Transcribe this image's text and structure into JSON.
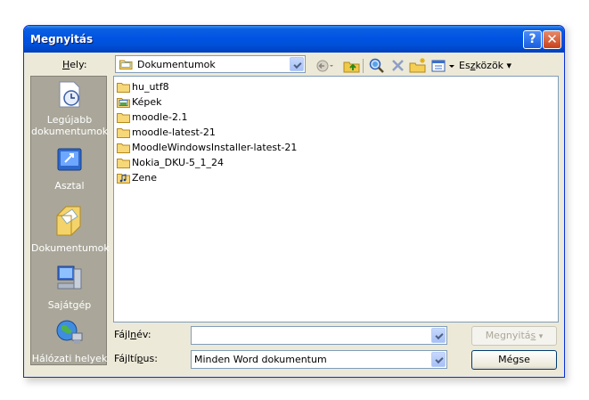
{
  "window": {
    "title": "Megnyitás",
    "help": "?",
    "close": "✕"
  },
  "location": {
    "label_pre": "",
    "label_key": "H",
    "label_post": "ely:",
    "value": "Dokumentumok"
  },
  "toolbar": {
    "tools_label_pre": "Es",
    "tools_label_key": "z",
    "tools_label_post": "közök",
    "icons": [
      "back-icon",
      "up-folder-icon",
      "search-web-icon",
      "delete-icon",
      "new-folder-icon",
      "views-icon"
    ]
  },
  "places": [
    {
      "label": "Legújabb dokumentumok",
      "icon": "recent-documents-icon"
    },
    {
      "label": "Asztal",
      "icon": "desktop-icon"
    },
    {
      "label": "Dokumentumok",
      "icon": "my-documents-icon"
    },
    {
      "label": "Sajátgép",
      "icon": "my-computer-icon"
    },
    {
      "label": "Hálózati helyek",
      "icon": "network-places-icon"
    }
  ],
  "files": [
    {
      "name": "hu_utf8",
      "icon": "folder-icon"
    },
    {
      "name": "Képek",
      "icon": "pictures-folder-icon"
    },
    {
      "name": "moodle-2.1",
      "icon": "folder-icon"
    },
    {
      "name": "moodle-latest-21",
      "icon": "folder-icon"
    },
    {
      "name": "MoodleWindowsInstaller-latest-21",
      "icon": "folder-icon"
    },
    {
      "name": "Nokia_DKU-5_1_24",
      "icon": "folder-icon"
    },
    {
      "name": "Zene",
      "icon": "music-folder-icon"
    }
  ],
  "filename": {
    "label_pre": "Fájl",
    "label_key": "n",
    "label_post": "év:",
    "value": ""
  },
  "filetype": {
    "label_pre": "Fájltí",
    "label_key": "p",
    "label_post": "us:",
    "value": "Minden Word dokumentum"
  },
  "buttons": {
    "open_pre": "Megnyitá",
    "open_key": "s",
    "cancel": "Mégse"
  }
}
